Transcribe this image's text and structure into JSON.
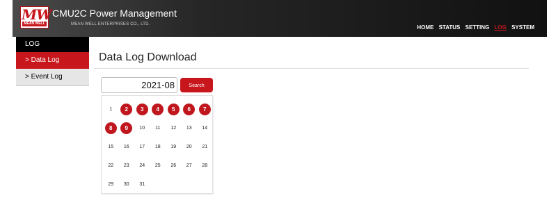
{
  "header": {
    "logo_text": "MW",
    "logo_subtext": "MEAN WELL",
    "app_title": "CMU2C Power Management",
    "company": "MEAN WELL ENTERPRISES CO., LTD.",
    "nav": [
      {
        "label": "HOME",
        "active": false
      },
      {
        "label": "STATUS",
        "active": false
      },
      {
        "label": "SETTING",
        "active": false
      },
      {
        "label": "LOG",
        "active": true
      },
      {
        "label": "SYSTEM",
        "active": false
      }
    ]
  },
  "sidebar": {
    "section": "LOG",
    "items": [
      {
        "label": "> Data Log",
        "active": true
      },
      {
        "label": "> Event Log",
        "active": false
      }
    ]
  },
  "main": {
    "title": "Data Log Download",
    "date_value": "2021-08",
    "search_label": "Search",
    "calendar": {
      "days": [
        1,
        2,
        3,
        4,
        5,
        6,
        7,
        8,
        9,
        10,
        11,
        12,
        13,
        14,
        15,
        16,
        17,
        18,
        19,
        20,
        21,
        22,
        23,
        24,
        25,
        26,
        27,
        28,
        29,
        30,
        31
      ],
      "highlighted": [
        2,
        3,
        4,
        5,
        6,
        7,
        8,
        9
      ]
    }
  },
  "colors": {
    "accent": "#c8161d",
    "header_bg": "#1a1a1a",
    "sidebar_head": "#000000",
    "sidebar_inactive": "#e6e6e6"
  }
}
